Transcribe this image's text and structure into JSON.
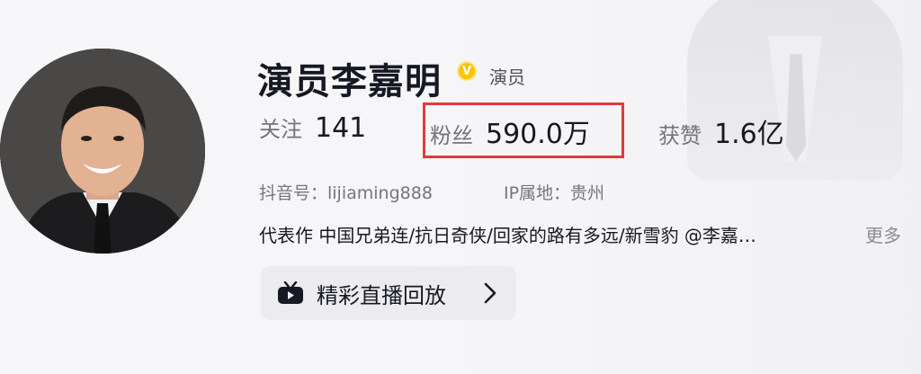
{
  "profile": {
    "name": "演员李嘉明",
    "verified_badge": "V",
    "role": "演员",
    "colors": {
      "verified": "#ffc300",
      "highlight_box": "#e03b3b"
    }
  },
  "stats": {
    "following": {
      "label": "关注",
      "value": "141"
    },
    "fans": {
      "label": "粉丝",
      "value": "590.0万"
    },
    "likes": {
      "label": "获赞",
      "value": "1.6亿"
    }
  },
  "meta": {
    "douyin_id": "抖音号：lijiaming888",
    "ip_location": "IP属地：贵州"
  },
  "bio": {
    "text": "代表作 中国兄弟连/抗日奇侠/回家的路有多远/新雪豹 @李嘉…",
    "more": "更多"
  },
  "live_replay": {
    "label": "精彩直播回放",
    "icon": "tv-icon"
  }
}
